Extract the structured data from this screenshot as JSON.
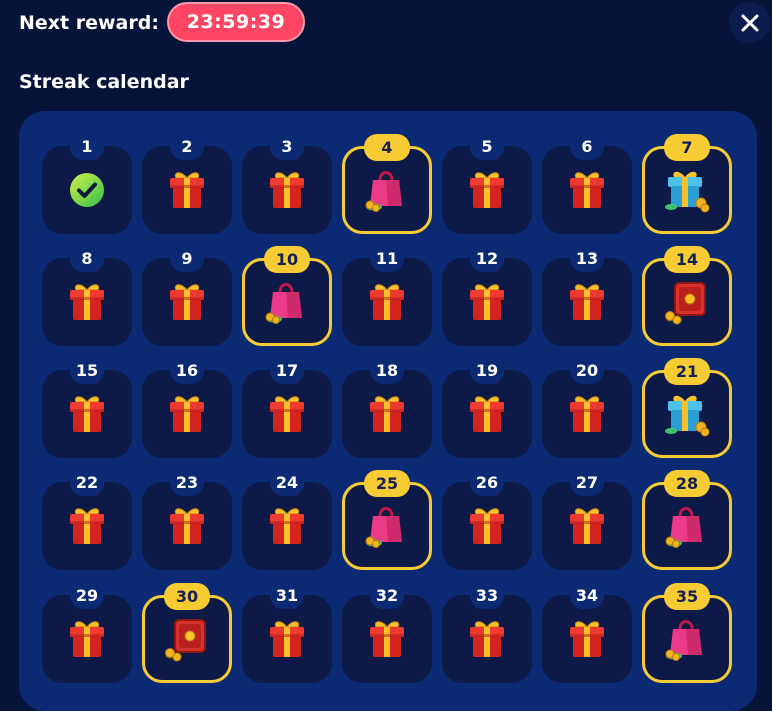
{
  "header": {
    "label": "Next reward:",
    "timer": "23:59:39"
  },
  "section_title": "Streak calendar",
  "icons": {
    "close": "close-icon"
  },
  "colors": {
    "background": "#061439",
    "panel": "#0b2a73",
    "cell": "#0d1a48",
    "accent_gold": "#f7cb33",
    "timer_red": "#ff4564"
  },
  "days": [
    {
      "n": "1",
      "reward": "checkmark",
      "special": false
    },
    {
      "n": "2",
      "reward": "gift",
      "special": false
    },
    {
      "n": "3",
      "reward": "gift",
      "special": false
    },
    {
      "n": "4",
      "reward": "shopping-bag",
      "special": true
    },
    {
      "n": "5",
      "reward": "gift",
      "special": false
    },
    {
      "n": "6",
      "reward": "gift",
      "special": false
    },
    {
      "n": "7",
      "reward": "blue-gift",
      "special": true
    },
    {
      "n": "8",
      "reward": "gift",
      "special": false
    },
    {
      "n": "9",
      "reward": "gift",
      "special": false
    },
    {
      "n": "10",
      "reward": "shopping-bag",
      "special": true
    },
    {
      "n": "11",
      "reward": "gift",
      "special": false
    },
    {
      "n": "12",
      "reward": "gift",
      "special": false
    },
    {
      "n": "13",
      "reward": "gift",
      "special": false
    },
    {
      "n": "14",
      "reward": "safe",
      "special": true
    },
    {
      "n": "15",
      "reward": "gift",
      "special": false
    },
    {
      "n": "16",
      "reward": "gift",
      "special": false
    },
    {
      "n": "17",
      "reward": "gift",
      "special": false
    },
    {
      "n": "18",
      "reward": "gift",
      "special": false
    },
    {
      "n": "19",
      "reward": "gift",
      "special": false
    },
    {
      "n": "20",
      "reward": "gift",
      "special": false
    },
    {
      "n": "21",
      "reward": "blue-gift",
      "special": true
    },
    {
      "n": "22",
      "reward": "gift",
      "special": false
    },
    {
      "n": "23",
      "reward": "gift",
      "special": false
    },
    {
      "n": "24",
      "reward": "gift",
      "special": false
    },
    {
      "n": "25",
      "reward": "shopping-bag",
      "special": true
    },
    {
      "n": "26",
      "reward": "gift",
      "special": false
    },
    {
      "n": "27",
      "reward": "gift",
      "special": false
    },
    {
      "n": "28",
      "reward": "shopping-bag",
      "special": true
    },
    {
      "n": "29",
      "reward": "gift",
      "special": false
    },
    {
      "n": "30",
      "reward": "safe",
      "special": true
    },
    {
      "n": "31",
      "reward": "gift",
      "special": false
    },
    {
      "n": "32",
      "reward": "gift",
      "special": false
    },
    {
      "n": "33",
      "reward": "gift",
      "special": false
    },
    {
      "n": "34",
      "reward": "gift",
      "special": false
    },
    {
      "n": "35",
      "reward": "shopping-bag",
      "special": true
    }
  ]
}
